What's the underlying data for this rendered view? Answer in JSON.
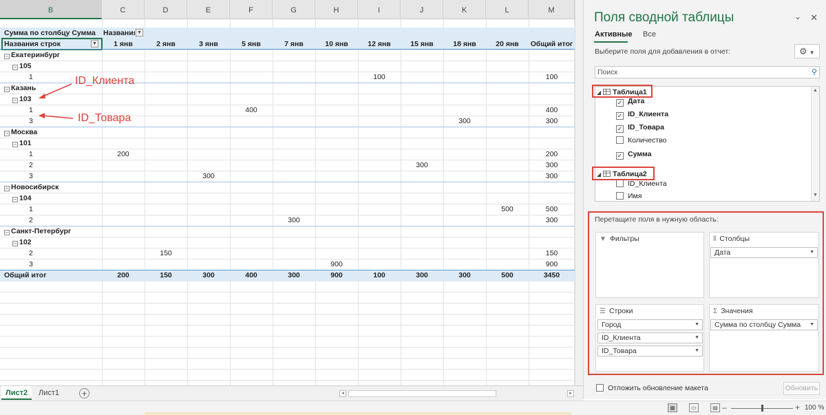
{
  "sheet": {
    "columns": [
      "B",
      "C",
      "D",
      "E",
      "F",
      "G",
      "H",
      "I",
      "J",
      "K",
      "L",
      "M"
    ],
    "pivot": {
      "title_label": "Сумма по столбцу Сумма",
      "col_header_label": "Названия столбцов",
      "row_header_label": "Названия строк",
      "dates": [
        "1 янв",
        "2 янв",
        "3 янв",
        "5 янв",
        "7 янв",
        "10 янв",
        "12 янв",
        "15 янв",
        "18 янв",
        "20 янв"
      ],
      "grand_total_col": "Общий итог",
      "rows": [
        {
          "label": "Екатеринбург",
          "level": 0
        },
        {
          "label": "105",
          "level": 1
        },
        {
          "label": "1",
          "level": 2,
          "cells": {
            "I": "100",
            "M": "100"
          }
        },
        {
          "label": "Казань",
          "level": 0
        },
        {
          "label": "103",
          "level": 1
        },
        {
          "label": "1",
          "level": 2,
          "cells": {
            "F": "400",
            "M": "400"
          }
        },
        {
          "label": "3",
          "level": 2,
          "cells": {
            "K": "300",
            "M": "300"
          }
        },
        {
          "label": "Москва",
          "level": 0
        },
        {
          "label": "101",
          "level": 1
        },
        {
          "label": "1",
          "level": 2,
          "cells": {
            "C": "200",
            "M": "200"
          }
        },
        {
          "label": "2",
          "level": 2,
          "cells": {
            "J": "300",
            "M": "300"
          }
        },
        {
          "label": "3",
          "level": 2,
          "cells": {
            "E": "300",
            "M": "300"
          }
        },
        {
          "label": "Новосибирск",
          "level": 0
        },
        {
          "label": "104",
          "level": 1
        },
        {
          "label": "1",
          "level": 2,
          "cells": {
            "L": "500",
            "M": "500"
          }
        },
        {
          "label": "2",
          "level": 2,
          "cells": {
            "G": "300",
            "M": "300"
          }
        },
        {
          "label": "Санкт-Петербург",
          "level": 0
        },
        {
          "label": "102",
          "level": 1
        },
        {
          "label": "2",
          "level": 2,
          "cells": {
            "D": "150",
            "M": "150"
          }
        },
        {
          "label": "3",
          "level": 2,
          "cells": {
            "H": "900",
            "M": "900"
          }
        }
      ],
      "grand_total_row": {
        "label": "Общий итог",
        "values": [
          "200",
          "150",
          "300",
          "400",
          "300",
          "900",
          "100",
          "300",
          "300",
          "500",
          "3450"
        ]
      }
    },
    "annotations": {
      "client": "ID_Клиента",
      "product": "ID_Товара"
    },
    "tabs": [
      "Лист2",
      "Лист1"
    ],
    "active_tab": "Лист2"
  },
  "pane": {
    "title": "Поля сводной таблицы",
    "tabs": [
      "Активные",
      "Все"
    ],
    "hint": "Выберите поля для добавления в отчет:",
    "search_placeholder": "Поиск",
    "tables": [
      {
        "name": "Таблица1",
        "fields": [
          {
            "name": "Дата",
            "checked": true
          },
          {
            "name": "ID_Клиента",
            "checked": true
          },
          {
            "name": "ID_Товара",
            "checked": true
          },
          {
            "name": "Количество",
            "checked": false
          },
          {
            "name": "Сумма",
            "checked": true
          }
        ]
      },
      {
        "name": "Таблица2",
        "fields": [
          {
            "name": "ID_Клиента",
            "checked": false
          },
          {
            "name": "Имя",
            "checked": false
          }
        ]
      }
    ],
    "areas_hint": "Перетащите поля в нужную область:",
    "areas": {
      "filters_label": "Фильтры",
      "columns_label": "Столбцы",
      "rows_label": "Строки",
      "values_label": "Значения",
      "columns_items": [
        "Дата"
      ],
      "rows_items": [
        "Город",
        "ID_Клиента",
        "ID_Товара"
      ],
      "values_items": [
        "Сумма по столбцу Сумма"
      ]
    },
    "defer_label": "Отложить обновление макета",
    "update_label": "Обновить"
  },
  "status": {
    "zoom": "100 %"
  },
  "colors": {
    "accent": "#217346",
    "annotation": "#e0403a",
    "pivot_band": "#ddebf7"
  }
}
